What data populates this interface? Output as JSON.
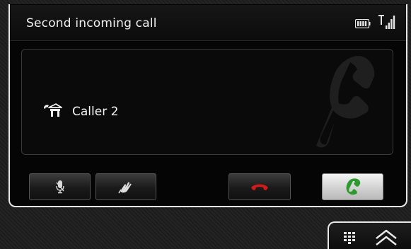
{
  "header": {
    "title": "Second incoming call",
    "battery_icon": "battery-icon",
    "signal_icon": "signal-strength-icon"
  },
  "caller": {
    "name": "Caller 2",
    "type_icon": "home-phone-icon",
    "watermark_icon": "handset-icon"
  },
  "buttons": {
    "mute": {
      "icon": "microphone-mute-icon"
    },
    "private": {
      "icon": "hand-icon"
    },
    "reject": {
      "icon": "hang-up-icon",
      "color": "#d11a1a"
    },
    "accept": {
      "icon": "answer-call-icon",
      "color": "#2e9a2e"
    }
  },
  "bottom_bar": {
    "keypad_icon": "keypad-icon",
    "up_icon": "chevron-up-icon"
  }
}
